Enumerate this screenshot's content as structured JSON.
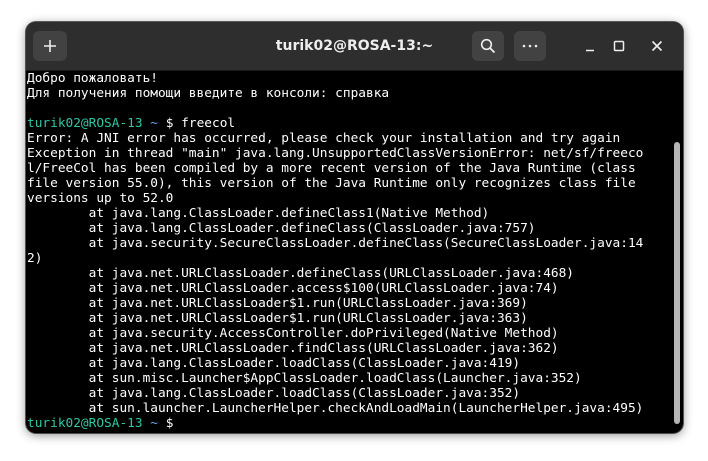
{
  "window": {
    "title": "turik02@ROSA-13:~"
  },
  "titlebar": {
    "icons": {
      "new_tab": "plus-icon",
      "search": "search-icon",
      "menu": "ellipsis-icon",
      "minimize": "minimize-icon",
      "maximize": "maximize-icon",
      "close": "close-icon"
    }
  },
  "colors": {
    "titlebar": "#2e2e2e",
    "terminal_bg": "#000000",
    "prompt_user": "#2fc7a4",
    "prompt_tilde": "#6aa3ea",
    "text": "#ffffff"
  },
  "terminal": {
    "welcome_line1": "Добро пожаловать!",
    "welcome_line2": "Для получения помощи введите в консоли: справка",
    "prompt1": {
      "user": "turik02@ROSA-13",
      "tilde": "~",
      "symbol": "$",
      "command": "freecol"
    },
    "output": [
      "Error: A JNI error has occurred, please check your installation and try again",
      "Exception in thread \"main\" java.lang.UnsupportedClassVersionError: net/sf/freeco",
      "l/FreeCol has been compiled by a more recent version of the Java Runtime (class",
      "file version 55.0), this version of the Java Runtime only recognizes class file",
      "versions up to 52.0",
      "        at java.lang.ClassLoader.defineClass1(Native Method)",
      "        at java.lang.ClassLoader.defineClass(ClassLoader.java:757)",
      "        at java.security.SecureClassLoader.defineClass(SecureClassLoader.java:14",
      "2)",
      "        at java.net.URLClassLoader.defineClass(URLClassLoader.java:468)",
      "        at java.net.URLClassLoader.access$100(URLClassLoader.java:74)",
      "        at java.net.URLClassLoader$1.run(URLClassLoader.java:369)",
      "        at java.net.URLClassLoader$1.run(URLClassLoader.java:363)",
      "        at java.security.AccessController.doPrivileged(Native Method)",
      "        at java.net.URLClassLoader.findClass(URLClassLoader.java:362)",
      "        at java.lang.ClassLoader.loadClass(ClassLoader.java:419)",
      "        at sun.misc.Launcher$AppClassLoader.loadClass(Launcher.java:352)",
      "        at java.lang.ClassLoader.loadClass(ClassLoader.java:352)",
      "        at sun.launcher.LauncherHelper.checkAndLoadMain(LauncherHelper.java:495)"
    ],
    "prompt2": {
      "user": "turik02@ROSA-13",
      "tilde": "~",
      "symbol": "$"
    }
  }
}
